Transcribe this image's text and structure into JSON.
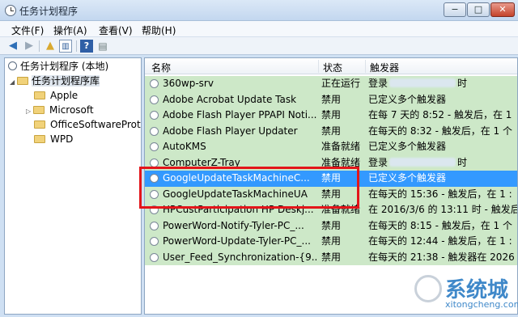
{
  "window": {
    "title": "任务计划程序",
    "min": "−",
    "max": "□",
    "close": "✕"
  },
  "menu": [
    "文件(F)",
    "操作(A)",
    "查看(V)",
    "帮助(H)"
  ],
  "toolbar": [
    "back-icon",
    "forward-icon",
    "up-folder-icon",
    "show-hide-tree-icon",
    "help-icon",
    "properties-icon"
  ],
  "tree": {
    "root": "任务计划程序 (本地)",
    "library": "任务计划程序库",
    "folders": [
      "Apple",
      "Microsoft",
      "OfficeSoftwareProt",
      "WPD"
    ]
  },
  "columns": {
    "name": "名称",
    "status": "状态",
    "trigger": "触发器"
  },
  "tasks": [
    {
      "name": "360wp-srv",
      "status": "正在运行",
      "trigger_a": "登录",
      "trigger_b": "时"
    },
    {
      "name": "Adobe Acrobat Update Task",
      "status": "禁用",
      "trigger": "已定义多个触发器"
    },
    {
      "name": "Adobe Flash Player PPAPI Noti...",
      "status": "禁用",
      "trigger": "在每 7 天的 8:52 - 触发后，在 1"
    },
    {
      "name": "Adobe Flash Player Updater",
      "status": "禁用",
      "trigger": "在每天的 8:32 - 触发后，在 1 个"
    },
    {
      "name": "AutoKMS",
      "status": "准备就绪",
      "trigger": "已定义多个触发器"
    },
    {
      "name": "ComputerZ-Tray",
      "status": "准备就绪",
      "trigger_a": "登录",
      "trigger_b": "时"
    },
    {
      "name": "GoogleUpdateTaskMachineC...",
      "status": "禁用",
      "trigger": "已定义多个触发器"
    },
    {
      "name": "GoogleUpdateTaskMachineUA",
      "status": "禁用",
      "trigger": "在每天的 15:36 - 触发后，在 1 :"
    },
    {
      "name": "HPCustParticipation HP Deskj...",
      "status": "准备就绪",
      "trigger": "在 2016/3/6 的 13:11 时 - 触发后"
    },
    {
      "name": "PowerWord-Notify-Tyler-PC_...",
      "status": "禁用",
      "trigger": "在每天的 8:15 - 触发后，在 1 个"
    },
    {
      "name": "PowerWord-Update-Tyler-PC_...",
      "status": "禁用",
      "trigger": "在每天的 12:44 - 触发后，在 1 :"
    },
    {
      "name": "User_Feed_Synchronization-{9...",
      "status": "禁用",
      "trigger": "在每天的 21:38 - 触发器在 2026"
    }
  ],
  "watermark": {
    "main": "系统城",
    "sub": "xitongcheng.com"
  }
}
